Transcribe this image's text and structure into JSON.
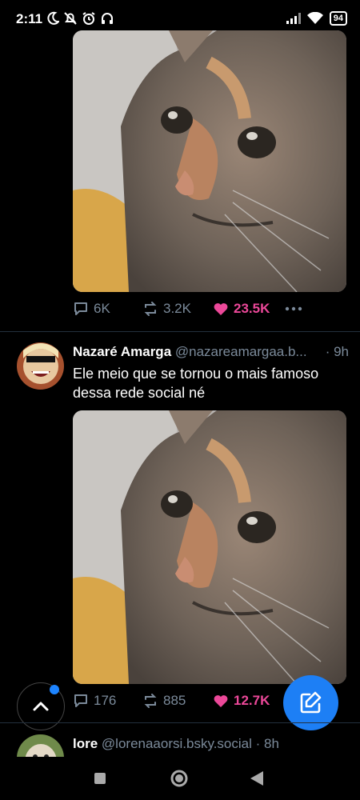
{
  "status_bar": {
    "time": "2:11",
    "battery": "94",
    "icons": [
      "moon-icon",
      "bell-off-icon",
      "alarm-icon",
      "headset-icon",
      "signal-icon",
      "wifi-icon",
      "battery-icon"
    ]
  },
  "post1": {
    "media": "cat-photo",
    "stats": {
      "replies": "6K",
      "reposts": "3.2K",
      "likes": "23.5K"
    }
  },
  "post2": {
    "author": "Nazaré Amarga",
    "handle": "@nazareamargaa.b...",
    "time": "· 9h",
    "text": "Ele meio que se tornou o mais famoso dessa rede social né",
    "media": "cat-photo",
    "stats": {
      "replies": "176",
      "reposts": "885",
      "likes": "12.7K"
    }
  },
  "post3": {
    "author": "lore",
    "handle": "@lorenaaorsi.bsky.social",
    "time": "· 8h"
  },
  "colors": {
    "background": "#000000",
    "muted": "#7b8a9a",
    "like": "#ec4899",
    "accent": "#1d7ff5"
  }
}
